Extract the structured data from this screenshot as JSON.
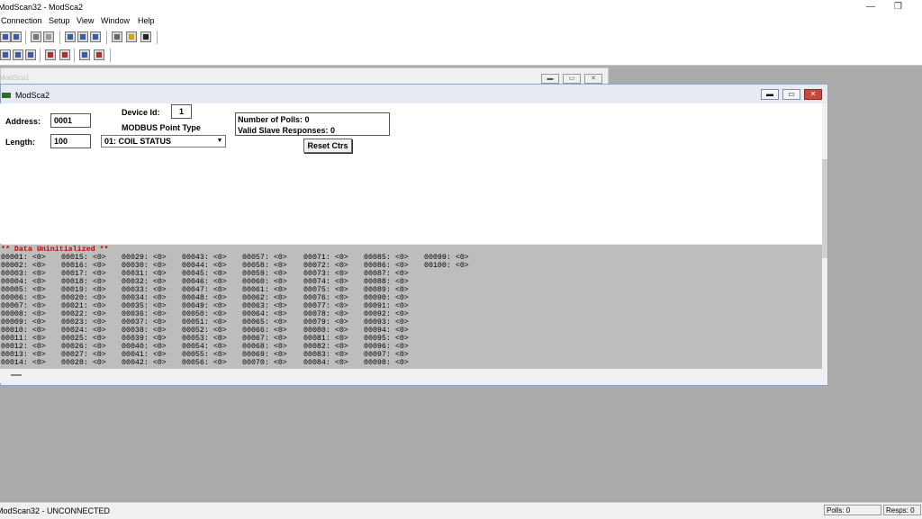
{
  "app_title": "ModScan32 - ModSca2",
  "window_controls": {
    "minimize": "—",
    "restore": "❐"
  },
  "menu": [
    "Connection",
    "Setup",
    "View",
    "Window",
    "Help"
  ],
  "background_window": {
    "title": "ModSca1"
  },
  "child_window": {
    "title": "ModSca2",
    "address_label": "Address:",
    "address_value": "0001",
    "length_label": "Length:",
    "length_value": "100",
    "device_id_label": "Device Id:",
    "device_id_value": "1",
    "point_type_label": "MODBUS Point Type",
    "point_type_value": "01: COIL STATUS",
    "polls_text": "Number of Polls: 0",
    "responses_text": "Valid Slave Responses: 0",
    "reset_label": "Reset Ctrs"
  },
  "data_header": "** Data Uninitialized **",
  "data_columns": [
    [
      "00001: <0>",
      "00002: <0>",
      "00003: <0>",
      "00004: <0>",
      "00005: <0>",
      "00006: <0>",
      "00007: <0>",
      "00008: <0>",
      "00009: <0>",
      "00010: <0>",
      "00011: <0>",
      "00012: <0>",
      "00013: <0>",
      "00014: <0>"
    ],
    [
      "00015: <0>",
      "00016: <0>",
      "00017: <0>",
      "00018: <0>",
      "00019: <0>",
      "00020: <0>",
      "00021: <0>",
      "00022: <0>",
      "00023: <0>",
      "00024: <0>",
      "00025: <0>",
      "00026: <0>",
      "00027: <0>",
      "00028: <0>"
    ],
    [
      "00029: <0>",
      "00030: <0>",
      "00031: <0>",
      "00032: <0>",
      "00033: <0>",
      "00034: <0>",
      "00035: <0>",
      "00036: <0>",
      "00037: <0>",
      "00038: <0>",
      "00039: <0>",
      "00040: <0>",
      "00041: <0>",
      "00042: <0>"
    ],
    [
      "00043: <0>",
      "00044: <0>",
      "00045: <0>",
      "00046: <0>",
      "00047: <0>",
      "00048: <0>",
      "00049: <0>",
      "00050: <0>",
      "00051: <0>",
      "00052: <0>",
      "00053: <0>",
      "00054: <0>",
      "00055: <0>",
      "00056: <0>"
    ],
    [
      "00057: <0>",
      "00058: <0>",
      "00059: <0>",
      "00060: <0>",
      "00061: <0>",
      "00062: <0>",
      "00063: <0>",
      "00064: <0>",
      "00065: <0>",
      "00066: <0>",
      "00067: <0>",
      "00068: <0>",
      "00069: <0>",
      "00070: <0>"
    ],
    [
      "00071: <0>",
      "00072: <0>",
      "00073: <0>",
      "00074: <0>",
      "00075: <0>",
      "00076: <0>",
      "00077: <0>",
      "00078: <0>",
      "00079: <0>",
      "00080: <0>",
      "00081: <0>",
      "00082: <0>",
      "00083: <0>",
      "00084: <0>"
    ],
    [
      "00085: <0>",
      "00086: <0>",
      "00087: <0>",
      "00088: <0>",
      "00089: <0>",
      "00090: <0>",
      "00091: <0>",
      "00092: <0>",
      "00093: <0>",
      "00094: <0>",
      "00095: <0>",
      "00096: <0>",
      "00097: <0>",
      "00098: <0>"
    ],
    [
      "00099: <0>",
      "00100: <0>"
    ]
  ],
  "status_bar": {
    "left": "ModScan32 - UNCONNECTED",
    "polls": "Polls: 0",
    "resps": "Resps: 0"
  },
  "colors": {
    "data_header": "#d00000",
    "data_bg": "#bdbdbd",
    "close_button": "#c9463b"
  }
}
